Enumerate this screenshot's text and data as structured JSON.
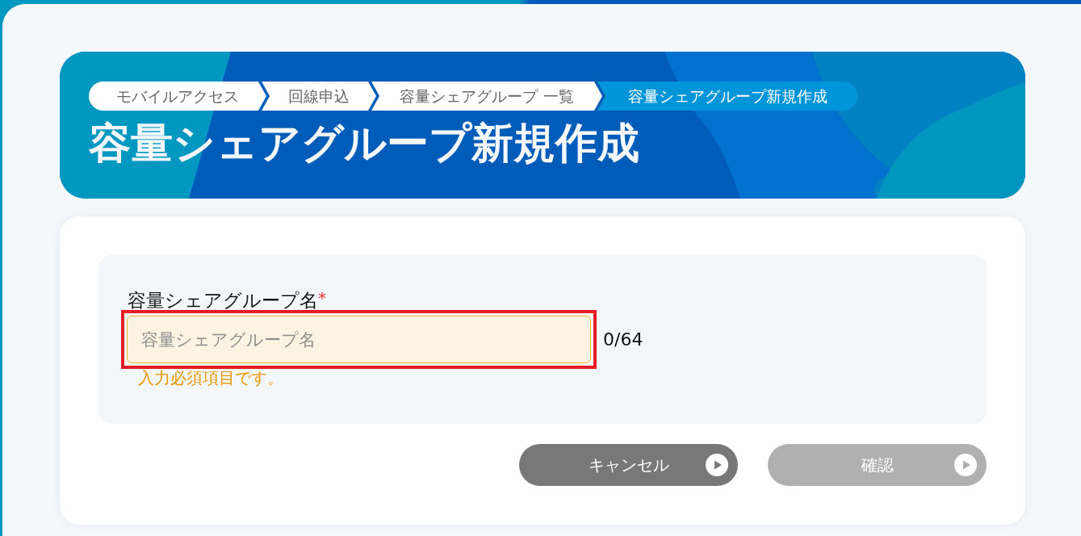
{
  "breadcrumbs": [
    {
      "label": "モバイルアクセス",
      "selected": false
    },
    {
      "label": "回線申込",
      "selected": false
    },
    {
      "label": "容量シェアグループ 一覧",
      "selected": false
    },
    {
      "label": "容量シェアグループ新規作成",
      "selected": true
    }
  ],
  "page_title": "容量シェアグループ新規作成",
  "form": {
    "field": {
      "label": "容量シェアグループ名",
      "required_mark": "*",
      "placeholder": "容量シェアグループ名",
      "counter": "0/64",
      "error": "入力必須項目です。",
      "invalid": true,
      "highlighted": true
    }
  },
  "buttons": [
    {
      "label": "キャンセル",
      "disabled": false
    },
    {
      "label": "確認",
      "disabled": true
    }
  ]
}
